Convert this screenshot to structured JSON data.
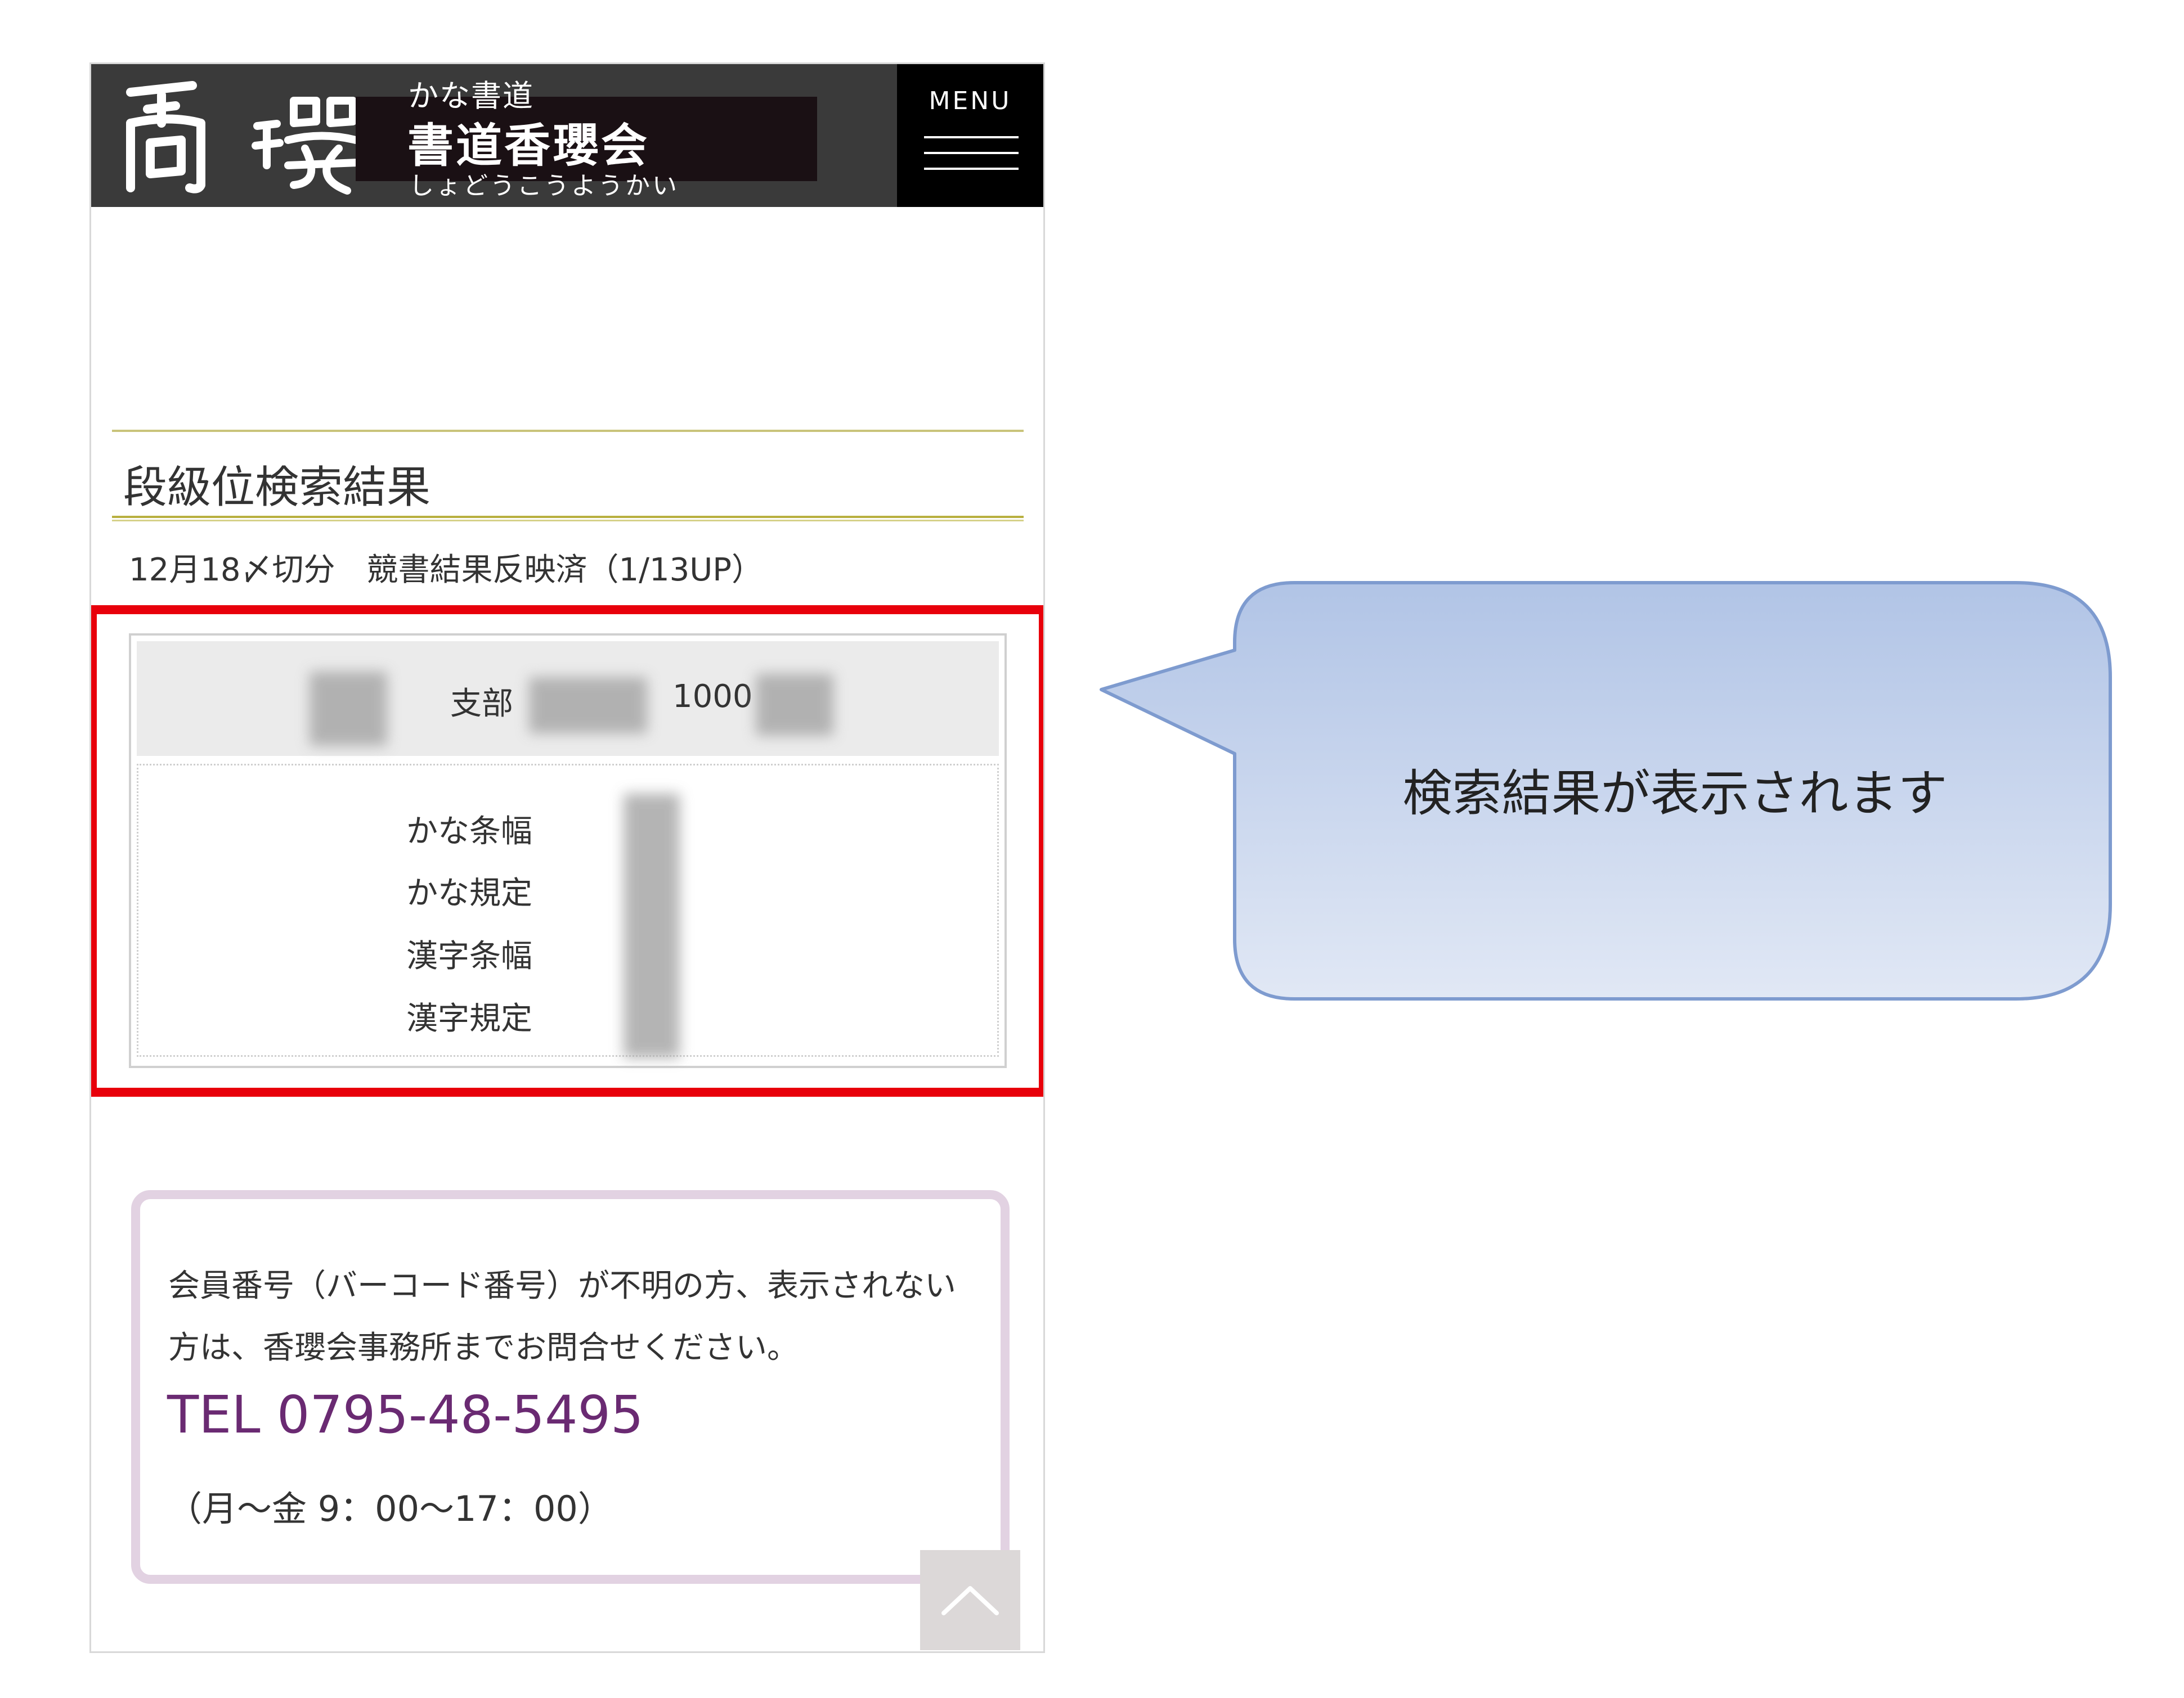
{
  "header": {
    "logo_small": "かな書道",
    "logo_main": "書道香瓔会",
    "logo_kana": "しょどうこうようかい",
    "menu_label": "MENU"
  },
  "page": {
    "title": "段級位検索結果",
    "update_note": "12月18〆切分　競書結果反映済（1/13UP）"
  },
  "result": {
    "branch_suffix": "支部",
    "member_number_prefix": "1000",
    "grade_rows": [
      {
        "label": "かな条幅"
      },
      {
        "label": "かな規定"
      },
      {
        "label": "漢字条幅"
      },
      {
        "label": "漢字規定"
      }
    ]
  },
  "notice": {
    "text": "会員番号（バーコード番号）が不明の方、表示されない方は、香瓔会事務所までお問合せください。",
    "tel": "TEL 0795-48-5495",
    "hours": "（月～金 9：00～17：00）"
  },
  "callout": {
    "text": "検索結果が表示されます"
  },
  "icons": {
    "menu": "hamburger-icon",
    "to_top": "chevron-up-icon"
  },
  "colors": {
    "header_bg": "#3a3a3a",
    "menu_bg": "#000000",
    "title_rule": "#b8b040",
    "highlight": "#e8000b",
    "notice_border": "#e2d2e2",
    "tel": "#6a2a72",
    "callout_fill_top": "#b1c4e6",
    "callout_fill_bottom": "#e1e8f5",
    "callout_stroke": "#7e9bcf"
  }
}
